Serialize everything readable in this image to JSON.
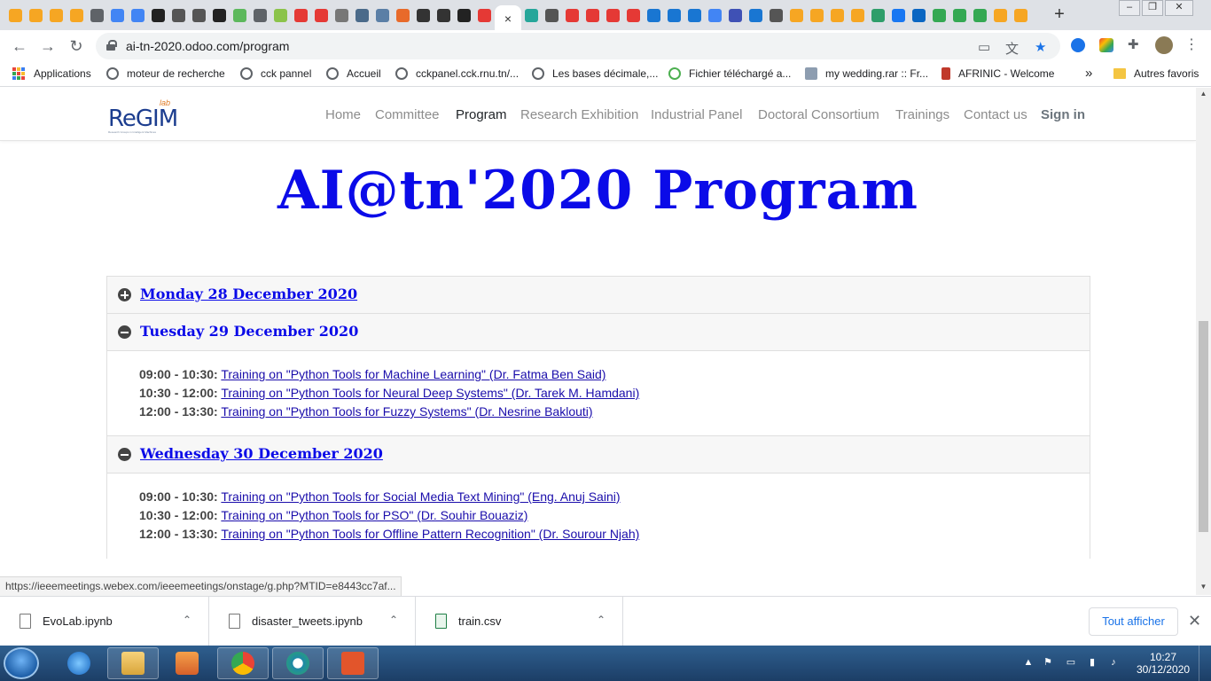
{
  "browser": {
    "url": "ai-tn-2020.odoo.com/program",
    "new_tab_symbol": "+",
    "close_tab_symbol": "×",
    "window_controls": {
      "minimize": "–",
      "maximize": "❐",
      "close": "✕"
    },
    "bookmarks": [
      {
        "label": "Applications",
        "icon": "apps-grid-icon"
      },
      {
        "label": "moteur de recherche",
        "icon": "globe-icon"
      },
      {
        "label": "cck pannel",
        "icon": "globe-icon"
      },
      {
        "label": "Accueil",
        "icon": "globe-icon"
      },
      {
        "label": "cckpanel.cck.rnu.tn/...",
        "icon": "globe-icon"
      },
      {
        "label": "Les bases décimale,...",
        "icon": "globe-icon"
      },
      {
        "label": "Fichier téléchargé a...",
        "icon": "download-site-icon"
      },
      {
        "label": "my wedding.rar :: Fr...",
        "icon": "file-site-icon"
      },
      {
        "label": "AFRINIC - Welcome",
        "icon": "afrinic-icon"
      }
    ],
    "more_bookmarks": "»",
    "other_bookmarks": "Autres favoris",
    "status_url": "https://ieeemeetings.webex.com/ieeemeetings/onstage/g.php?MTID=e8443cc7af..."
  },
  "site": {
    "logo_text": "ReGIM",
    "logo_lab": "lab",
    "logo_tagline": "Research Groups in Intelligent Machines",
    "nav": [
      {
        "label": "Home"
      },
      {
        "label": "Committee"
      },
      {
        "label": "Program",
        "active": true
      },
      {
        "label": "Research Exhibition"
      },
      {
        "label": "Industrial Panel"
      },
      {
        "label": "Doctoral Consortium"
      },
      {
        "label": "Trainings"
      },
      {
        "label": "Contact us"
      }
    ],
    "sign_in": "Sign in"
  },
  "page": {
    "title": "AI@tn'2020 Program",
    "title_color": "#0b0be8",
    "days": [
      {
        "label": "Monday 28 December 2020",
        "expanded": false,
        "sessions": []
      },
      {
        "label": "Tuesday 29 December 2020",
        "expanded": true,
        "sessions": [
          {
            "time": "09:00 - 10:30:",
            "title": "Training on \"Python Tools for Machine Learning\" (Dr. Fatma Ben Said)"
          },
          {
            "time": "10:30 - 12:00:",
            "title": "Training on \"Python Tools for Neural Deep Systems\" (Dr. Tarek M. Hamdani)"
          },
          {
            "time": "12:00 - 13:30:",
            "title": "Training on \"Python Tools for Fuzzy Systems\" (Dr. Nesrine Baklouti)"
          }
        ]
      },
      {
        "label": "Wednesday 30 December 2020",
        "expanded": true,
        "sessions": [
          {
            "time": "09:00 - 10:30:",
            "title": "Training on \"Python Tools for Social Media Text Mining\" (Eng. Anuj Saini)"
          },
          {
            "time": "10:30 - 12:00:",
            "title": "Training on \"Python Tools for PSO\" (Dr. Souhir Bouaziz)"
          },
          {
            "time": "12:00 - 13:30:",
            "title": "Training on \"Python Tools for Offline Pattern Recognition\" (Dr. Sourour Njah)"
          }
        ]
      }
    ]
  },
  "downloads": {
    "items": [
      {
        "name": "EvoLab.ipynb",
        "type": "file"
      },
      {
        "name": "disaster_tweets.ipynb",
        "type": "file"
      },
      {
        "name": "train.csv",
        "type": "csv"
      }
    ],
    "show_all": "Tout afficher"
  },
  "taskbar": {
    "time": "10:27",
    "date": "30/12/2020"
  }
}
